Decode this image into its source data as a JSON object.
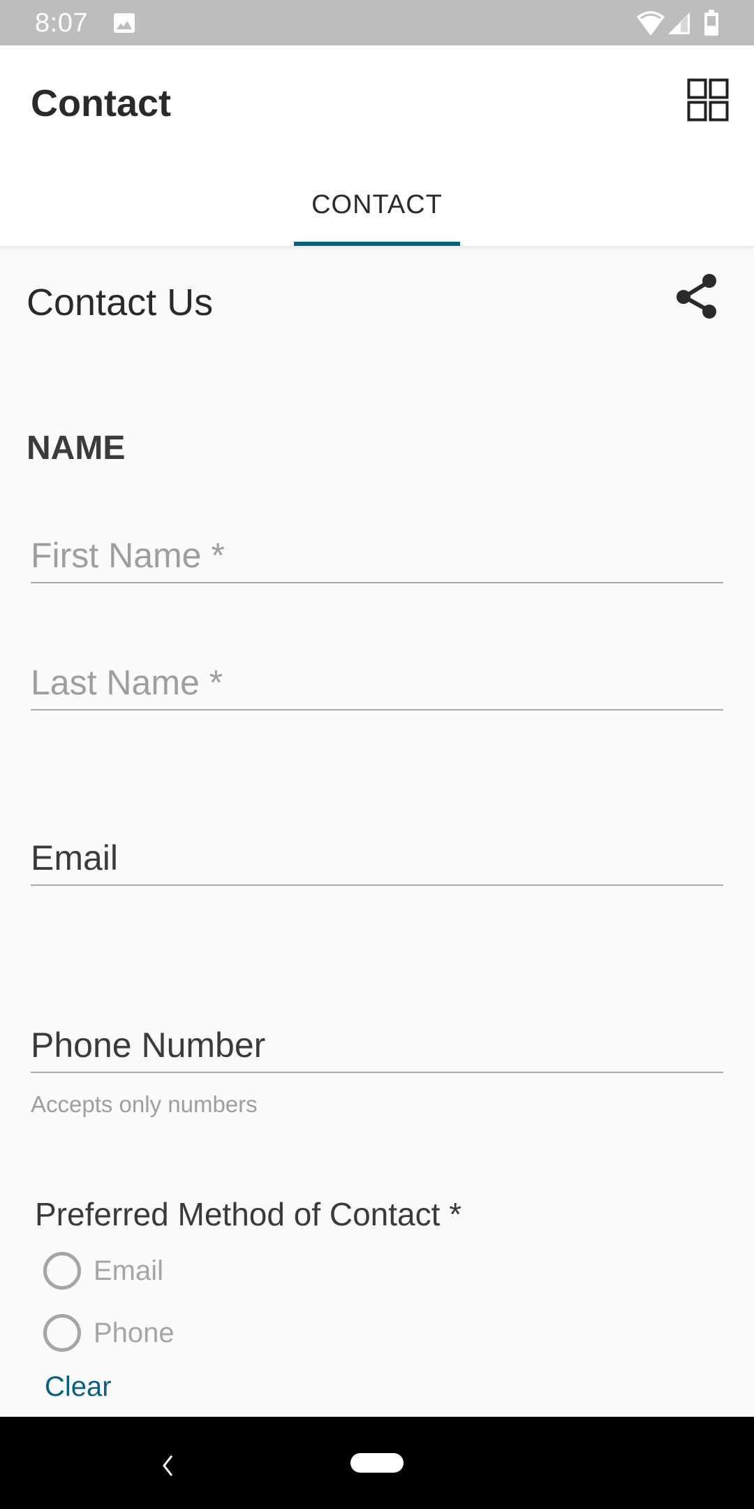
{
  "status_bar": {
    "time": "8:07",
    "icons": [
      "image-notification-icon",
      "wifi-icon",
      "cell-signal-icon",
      "battery-icon"
    ]
  },
  "app_bar": {
    "title": "Contact",
    "menu_icon": "grid-view-icon"
  },
  "tabs": [
    {
      "label": "CONTACT",
      "selected": true
    }
  ],
  "content": {
    "section_title": "Contact Us",
    "share_icon": "share-icon",
    "group_heading": "NAME",
    "fields": {
      "first_name": {
        "placeholder": "First Name *",
        "value": ""
      },
      "last_name": {
        "placeholder": "Last Name *",
        "value": ""
      },
      "email": {
        "label": "Email",
        "value": ""
      },
      "phone": {
        "label": "Phone Number",
        "value": "",
        "helper": "Accepts only numbers"
      }
    },
    "preferred_contact": {
      "label": "Preferred Method of Contact *",
      "options": [
        {
          "label": "Email",
          "selected": false
        },
        {
          "label": "Phone",
          "selected": false
        }
      ],
      "clear_label": "Clear"
    }
  },
  "nav_bar": {
    "back_icon": "back-icon",
    "home_icon": "home-pill-icon"
  },
  "colors": {
    "accent": "#0a5e80",
    "status_bar": "#bdbdbd",
    "background": "#fafafa",
    "placeholder": "#9e9e9e",
    "text_dark": "#2a2a2a"
  }
}
